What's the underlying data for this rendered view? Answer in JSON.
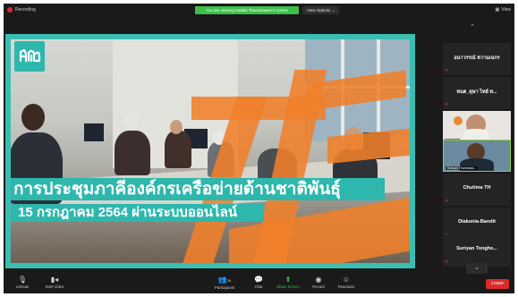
{
  "top_bar": {
    "recording_label": "Recording",
    "share_notice": "You are viewing Kaitaki Thantarawee's screen",
    "view_options_label": "View Options",
    "view_label": "View"
  },
  "shared_screen": {
    "title": "การประชุมภาคีองค์กรเครือข่ายด้านชาติพันธุ์",
    "subtitle": "15 กรกฎาคม 2564 ผ่านระบบออนไลน์",
    "brand_color": "#2eb7ad",
    "accent_color": "#f0802a"
  },
  "participants": [
    {
      "name": "อนาวรรณ์ หวานเฉกร",
      "has_video": false,
      "muted": true
    },
    {
      "name": "ทนต_ดุษา ไทย์ ท...",
      "has_video": false,
      "muted": true
    },
    {
      "name": "Katalina",
      "has_video": true,
      "muted": true,
      "active": false
    },
    {
      "name": "Suriyan Thanmasa...",
      "has_video": true,
      "muted": false,
      "active": true
    },
    {
      "name": "Chutima TH",
      "has_video": false,
      "muted": true
    },
    {
      "name": "Diakonia-Bandit",
      "has_video": false,
      "muted": true
    },
    {
      "name": "Suriyan Tonghe...",
      "has_video": false,
      "muted": true
    }
  ],
  "toolbar": {
    "unmute_label": "Unmute",
    "start_video_label": "Start Video",
    "participants_label": "Participants",
    "participants_count": "26",
    "chat_label": "Chat",
    "share_screen_label": "Share Screen",
    "record_label": "Record",
    "reactions_label": "Reactions",
    "leave_label": "Leave"
  },
  "colors": {
    "active_speaker": "#8fd631",
    "share_green": "#3dbf4a",
    "leave_red": "#d92b2b"
  }
}
